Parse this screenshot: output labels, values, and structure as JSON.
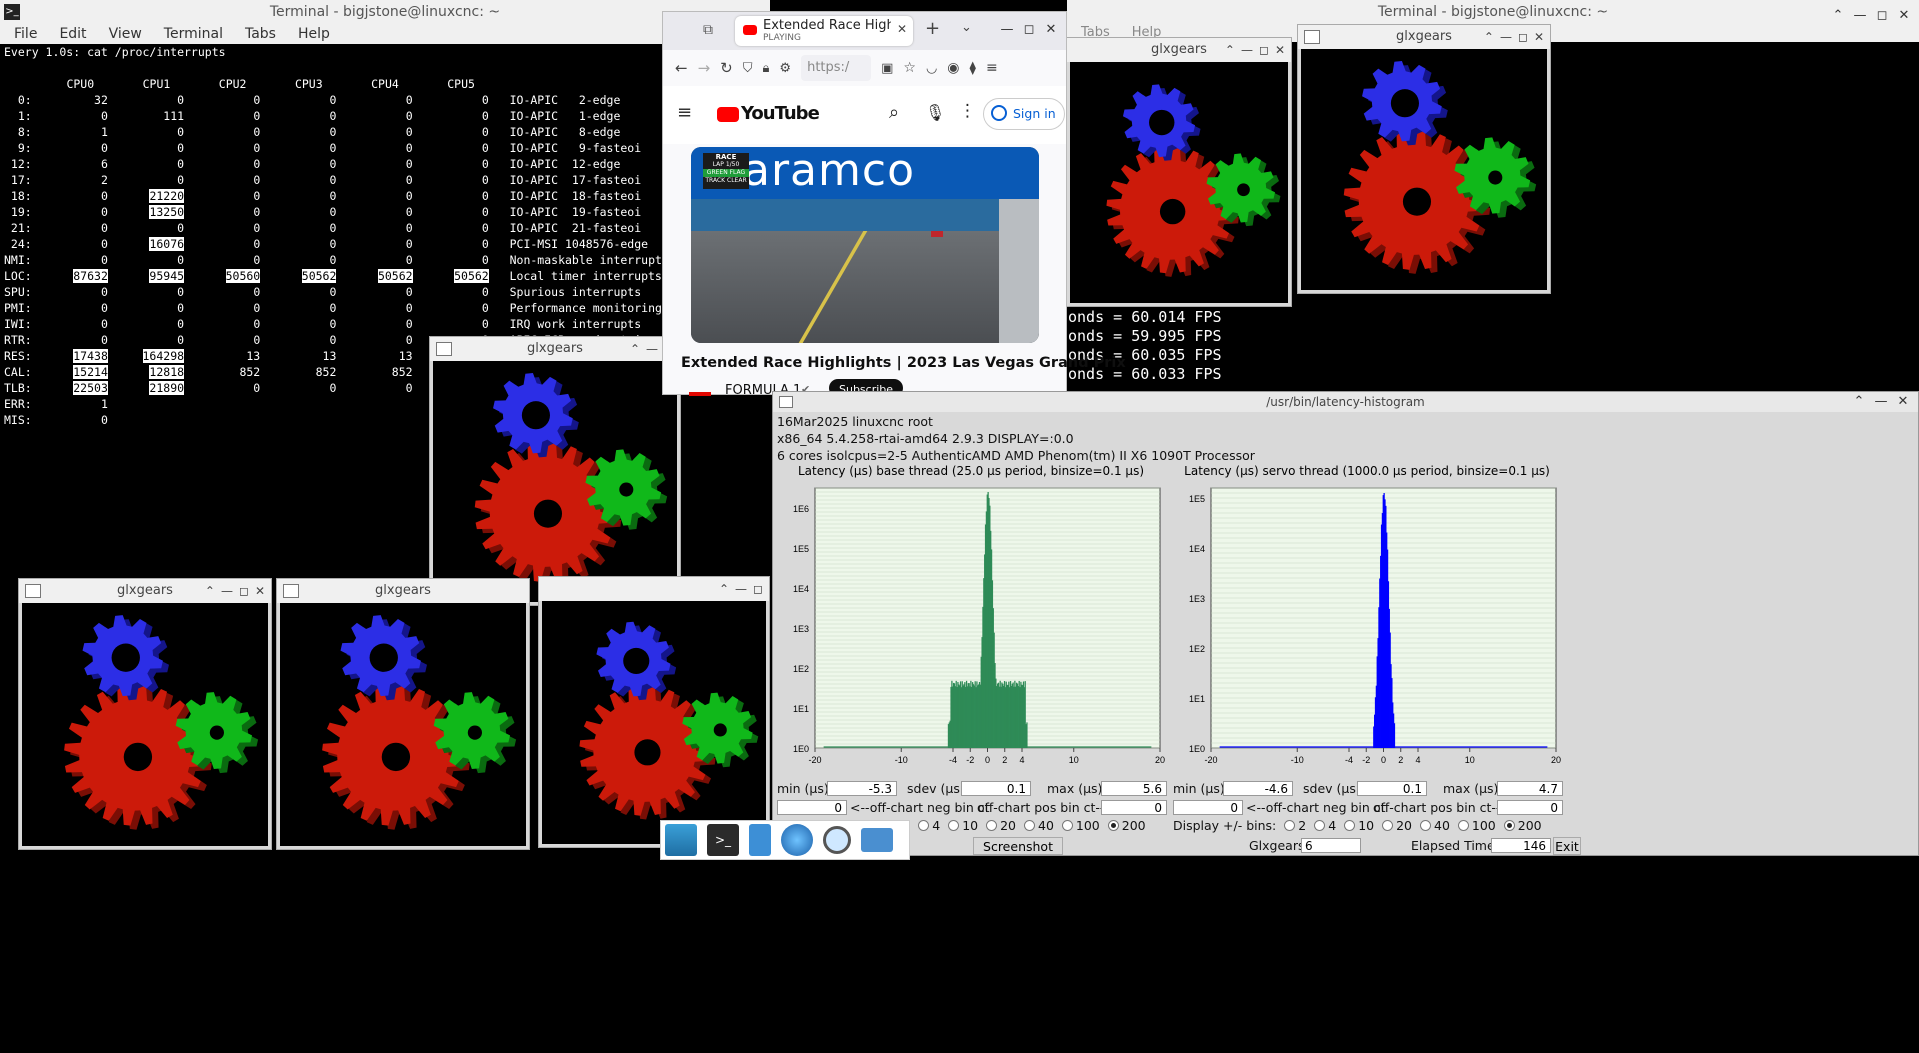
{
  "terminal_left": {
    "title": "Terminal - bigjstone@linuxcnc: ~",
    "menu": [
      "File",
      "Edit",
      "View",
      "Terminal",
      "Tabs",
      "Help"
    ],
    "watch_line": "Every 1.0s: cat /proc/interrupts",
    "cpu_header": "       CPU0       CPU1       CPU2       CPU3       CPU4       CPU5",
    "rows": [
      {
        "irq": "  0:",
        "c": [
          "32",
          "0",
          "0",
          "0",
          "0",
          "0"
        ],
        "desc": "IO-APIC   2-edge      timer"
      },
      {
        "irq": "  1:",
        "c": [
          "0",
          "111",
          "0",
          "0",
          "0",
          "0"
        ],
        "desc": "IO-APIC   1-edge      i8042"
      },
      {
        "irq": "  8:",
        "c": [
          "1",
          "0",
          "0",
          "0",
          "0",
          "0"
        ],
        "desc": "IO-APIC   8-edge      rtc0"
      },
      {
        "irq": "  9:",
        "c": [
          "0",
          "0",
          "0",
          "0",
          "0",
          "0"
        ],
        "desc": "IO-APIC   9-fasteoi   acpi"
      },
      {
        "irq": " 12:",
        "c": [
          "6",
          "0",
          "0",
          "0",
          "0",
          "0"
        ],
        "desc": "IO-APIC  12-edge      i8042"
      },
      {
        "irq": " 17:",
        "c": [
          "2",
          "0",
          "0",
          "0",
          "0",
          "0"
        ],
        "desc": "IO-APIC  17-fasteoi   pata_atiixp, ehci_hc"
      },
      {
        "irq": " 18:",
        "c": [
          "0",
          "21220",
          "0",
          "0",
          "0",
          "0"
        ],
        "desc": "IO-APIC  18-fasteoi   radeon, ohci_hcd:usb"
      },
      {
        "irq": " 19:",
        "c": [
          "0",
          "13250",
          "0",
          "0",
          "0",
          "0"
        ],
        "desc": "IO-APIC  19-fasteoi   ahci[0000:00:11.0]"
      },
      {
        "irq": " 21:",
        "c": [
          "0",
          "0",
          "0",
          "0",
          "0",
          "0"
        ],
        "desc": "IO-APIC  21-fasteoi   parport0, parport1"
      },
      {
        "irq": " 24:",
        "c": [
          "0",
          "16076",
          "0",
          "0",
          "0",
          "0"
        ],
        "desc": "PCI-MSI 1048576-edge      enp2s0"
      },
      {
        "irq": "NMI:",
        "c": [
          "0",
          "0",
          "0",
          "0",
          "0",
          "0"
        ],
        "desc": "Non-maskable interrupts"
      },
      {
        "irq": "LOC:",
        "c": [
          "87632",
          "95945",
          "50560",
          "50562",
          "50562",
          "50562"
        ],
        "desc": "Local timer interrupts"
      },
      {
        "irq": "SPU:",
        "c": [
          "0",
          "0",
          "0",
          "0",
          "0",
          "0"
        ],
        "desc": "Spurious interrupts"
      },
      {
        "irq": "PMI:",
        "c": [
          "0",
          "0",
          "0",
          "0",
          "0",
          "0"
        ],
        "desc": "Performance monitoring interrupts"
      },
      {
        "irq": "IWI:",
        "c": [
          "0",
          "0",
          "0",
          "0",
          "0",
          "0"
        ],
        "desc": "IRQ work interrupts"
      },
      {
        "irq": "RTR:",
        "c": [
          "0",
          "0",
          "0",
          "0",
          "0",
          "0"
        ],
        "desc": "APIC ICR read retries"
      },
      {
        "irq": "RES:",
        "c": [
          "17438",
          "164298",
          "13",
          "13",
          "13",
          "13"
        ],
        "desc": "Rescheduling interrupts"
      },
      {
        "irq": "CAL:",
        "c": [
          "15214",
          "12818",
          "852",
          "852",
          "852",
          "852"
        ],
        "desc": "Function call interrupts"
      },
      {
        "irq": "TLB:",
        "c": [
          "22503",
          "21890",
          "0",
          "0",
          "0",
          "0"
        ],
        "desc": "TLB shootdowns"
      },
      {
        "irq": "ERR:",
        "c": [
          "1"
        ],
        "desc": ""
      },
      {
        "irq": "MIS:",
        "c": [
          "0"
        ],
        "desc": ""
      }
    ]
  },
  "terminal_right": {
    "title": "Terminal - bigjstone@linuxcnc: ~",
    "menu_partial": [
      "Tabs",
      "Help"
    ],
    "fps_lines": [
      "onds = 60.014 FPS",
      "onds = 59.995 FPS",
      "onds = 60.035 FPS",
      "onds = 60.033 FPS"
    ]
  },
  "glxgears_title": "glxgears",
  "firefox": {
    "tab_title": "Extended Race Highlight",
    "tab_status": "PLAYING",
    "url": "https:/",
    "yt_logo": "YouTube",
    "signin": "Sign in",
    "thumb_brand": "aramco",
    "thumb_badge": [
      "RACE",
      "LAP 1/50",
      "GREEN FLAG",
      "TRACK CLEAR"
    ],
    "video_title": "Extended Race Highlights | 2023 Las Vegas Grand Prix",
    "channel": "FORMULA 1",
    "subscribe": "Subscribe"
  },
  "histogram": {
    "window_title": "/usr/bin/latency-histogram",
    "info": [
      "16Mar2025 linuxcnc root",
      "x86_64  5.4.258-rtai-amd64  2.9.3  DISPLAY=:0.0",
      "6 cores  isolcpus=2-5   AuthenticAMD  AMD Phenom(tm) II X6 1090T Processor"
    ],
    "base": {
      "title": "Latency (µs) base thread (25.0 µs period, binsize=0.1 µs)",
      "min_label": "min (µs)",
      "min": "-5.3",
      "sdev_label": "sdev (µs)",
      "sdev": "0.1",
      "max_label": "max (µs)",
      "max": "5.6",
      "neg": "0",
      "neg_label": "<--off-chart neg bin ct",
      "pos_label": "off-chart pos bin ct-->",
      "pos": "0",
      "bins_label": "Display +/- bins:",
      "bins": [
        "2",
        "4",
        "10",
        "20",
        "40",
        "100",
        "200"
      ]
    },
    "servo": {
      "title": "Latency (µs) servo thread (1000.0 µs period, binsize=0.1 µs)",
      "min_label": "min (µs)",
      "min": "-4.6",
      "sdev_label": "sdev (µs)",
      "sdev": "0.1",
      "max_label": "max (µs)",
      "max": "4.7",
      "neg": "0",
      "neg_label": "<--off-chart neg bin ct",
      "pos_label": "off-chart pos bin ct-->",
      "pos": "0",
      "bins_label": "Display +/- bins:",
      "bins": [
        "2",
        "4",
        "10",
        "20",
        "40",
        "100",
        "200"
      ]
    },
    "selected_bins": "200",
    "screenshot_button": "Screenshot",
    "glxgears_label": "Glxgears",
    "glxgears_count": "6",
    "elapsed_label": "Elapsed Time:",
    "elapsed": "146",
    "exit_button": "Exit",
    "x_ticks": [
      "-20",
      "-10",
      "-4",
      "-2",
      "0",
      "2",
      "4",
      "10",
      "20"
    ],
    "base_y_ticks": [
      "1E0",
      "1E1",
      "1E2",
      "1E3",
      "1E4",
      "1E5",
      "1E6"
    ],
    "servo_y_ticks": [
      "1E0",
      "1E1",
      "1E2",
      "1E3",
      "1E4",
      "1E5"
    ],
    "base_color": "#2e8b57",
    "servo_color": "#0000ff"
  }
}
